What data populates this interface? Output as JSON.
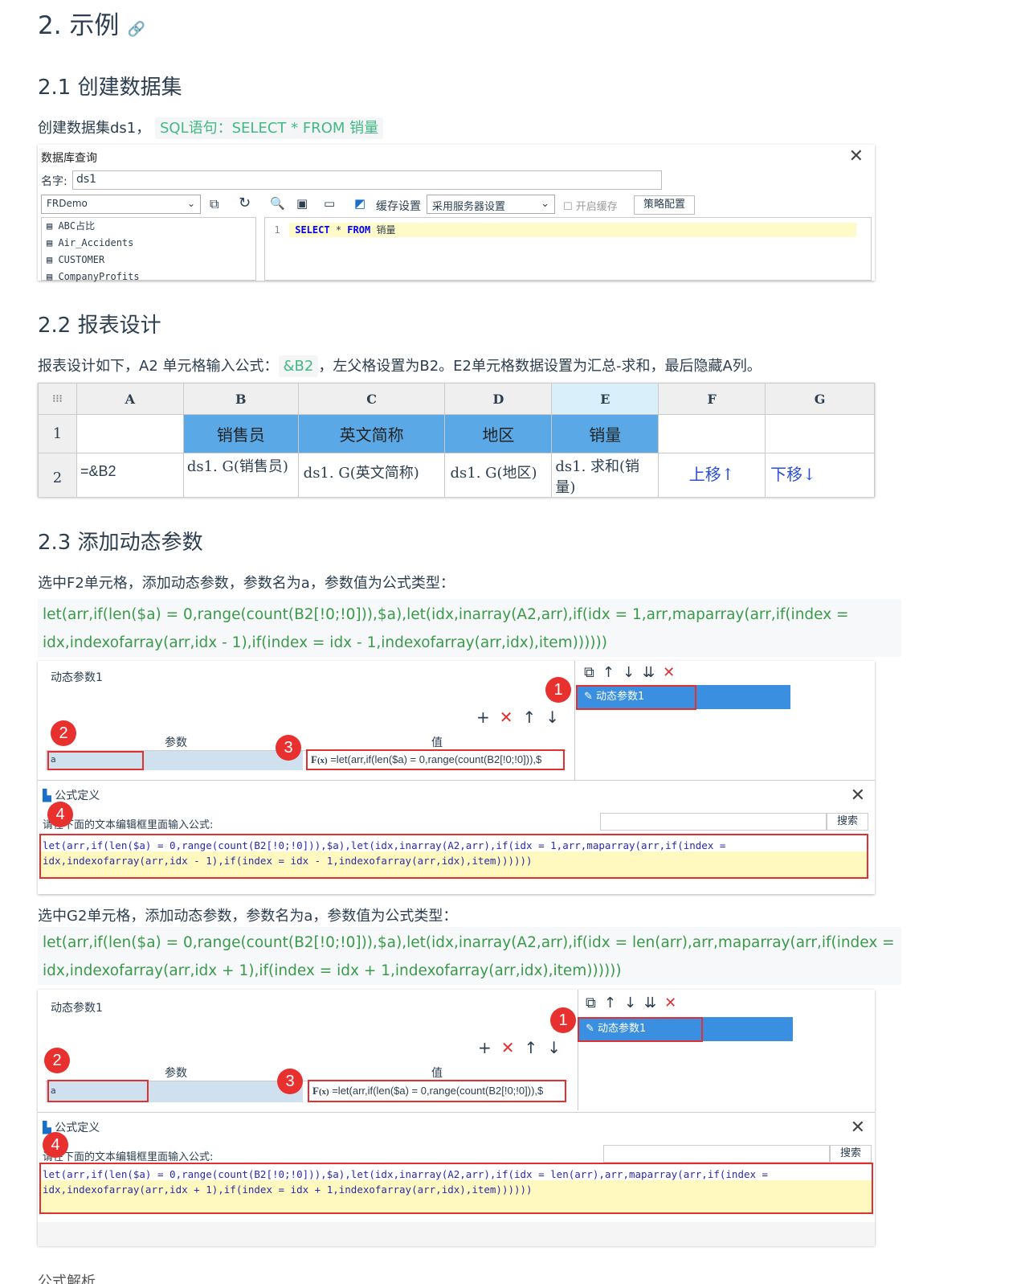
{
  "section_title": "2. 示例",
  "anchor_icon": "link-icon",
  "s21": {
    "title": "2.1 创建数据集",
    "text": "创建数据集ds1，",
    "code": "SQL语句：SELECT * FROM 销量"
  },
  "dbq": {
    "title": "数据库查询",
    "name_label": "名字:",
    "name_value": "ds1",
    "db": "FRDemo",
    "cache_label": "缓存设置",
    "cache_value": "采用服务器设置",
    "cache_toggle": "开启缓存",
    "policy": "策略配置",
    "tables": [
      "ABC占比",
      "Air_Accidents",
      "CUSTOMER",
      "CompanyProfits"
    ],
    "line_no": "1",
    "sql_kw1": "SELECT",
    "sql_star": "*",
    "sql_kw2": "FROM",
    "sql_table": "销量"
  },
  "s22": {
    "title": "2.2 报表设计",
    "text_a": "报表设计如下，A2 单元格输入公式：",
    "code": "&B2",
    "text_b": "，左父格设置为B2。E2单元格数据设置为汇总-求和，最后隐藏A列。"
  },
  "sheet": {
    "cols": [
      "A",
      "B",
      "C",
      "D",
      "E",
      "F",
      "G"
    ],
    "rows": [
      "1",
      "2"
    ],
    "r1": [
      "",
      "销售员",
      "英文简称",
      "地区",
      "销量",
      "",
      ""
    ],
    "r2": [
      "=&B2",
      "ds1. G(销售员)",
      "ds1. G(英文简称)",
      "ds1. G(地区)",
      "ds1. 求和(销量)",
      "上移↑",
      "下移↓"
    ]
  },
  "s23": {
    "title": "2.3 添加动态参数",
    "f2_text": "选中F2单元格，添加动态参数，参数名为a，参数值为公式类型：",
    "f2_code_l1": "let(arr,if(len($a) = 0,range(count(B2[!0;!0])),$a),let(idx,inarray(A2,arr),if(idx = 1,arr,maparray(arr,if(index =",
    "f2_code_l2": "idx,indexofarray(arr,idx - 1),if(index = idx - 1,indexofarray(arr,idx),item))))))",
    "g2_text": "选中G2单元格，添加动态参数，参数名为a，参数值为公式类型：",
    "g2_code_l1": "let(arr,if(len($a) = 0,range(count(B2[!0;!0])),$a),let(idx,inarray(A2,arr),if(idx = len(arr),arr,maparray(arr,if(index =",
    "g2_code_l2": "idx,indexofarray(arr,idx + 1),if(index = idx + 1,indexofarray(arr,idx),item))))))"
  },
  "dyn": {
    "panel_title": "动态参数1",
    "list_item": "动态参数1",
    "col_param": "参数",
    "col_value": "值",
    "param_name": "a",
    "value_preview": "=let(arr,if(len($a) = 0,range(count(B2[!0;!0])),$",
    "badges": [
      "1",
      "2",
      "3",
      "4"
    ]
  },
  "formula": {
    "title": "公式定义",
    "prompt": "请在下面的文本编辑框里面输入公式:",
    "search": "搜索"
  },
  "footer_partial": "公式解析"
}
